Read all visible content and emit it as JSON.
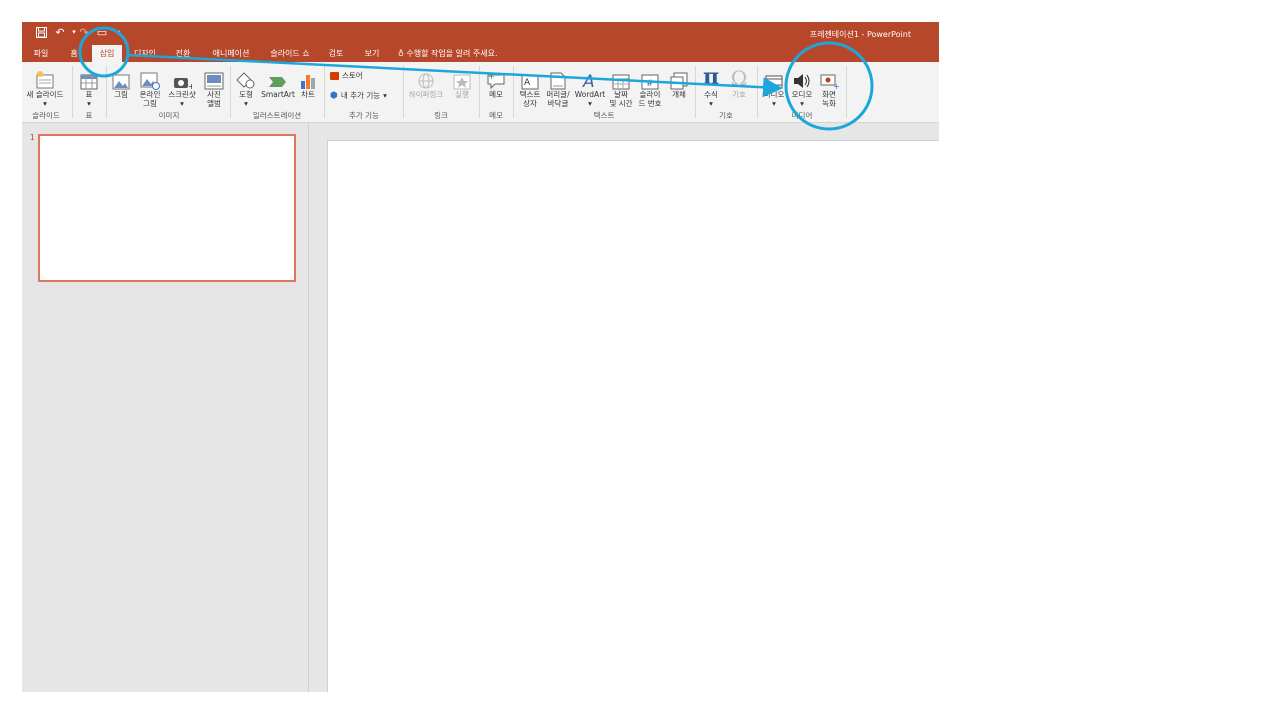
{
  "window": {
    "title": "프레젠테이션1 - PowerPoint"
  },
  "tabs": [
    "파일",
    "홈",
    "삽입",
    "디자인",
    "전환",
    "애니메이션",
    "슬라이드 쇼",
    "검토",
    "보기"
  ],
  "tell_me": "수행할 작업을 알려 주세요.",
  "ribbon": {
    "new_slide": "새 슬라이드",
    "table": "표",
    "picture": "그림",
    "online_picture": "온라인\n그림",
    "screenshot": "스크린샷",
    "photo_album": "사진\n앨범",
    "shapes": "도형",
    "smartart": "SmartArt",
    "chart": "차트",
    "store": "스토어",
    "my_addins": "내 추가 기능",
    "hyperlink": "하이퍼링크",
    "action": "실행",
    "comment": "메모",
    "textbox": "텍스트\n상자",
    "header_footer": "머리글/\n바닥글",
    "wordart": "WordArt",
    "date_time": "날짜\n및 시간",
    "slide_number": "슬라이\n드 번호",
    "object": "개체",
    "equation": "수식",
    "symbol": "기호",
    "video": "비디오",
    "audio": "오디오",
    "screen_recording": "화면\n녹화"
  },
  "groups": {
    "slides": "슬라이드",
    "tables": "표",
    "images": "이미지",
    "illustrations": "일러스트레이션",
    "addins": "추가 기능",
    "links": "링크",
    "comments": "메모",
    "text": "텍스트",
    "symbols": "기호",
    "media": "미디어"
  },
  "thumbnails": [
    {
      "number": "1"
    }
  ],
  "colors": {
    "accent": "#b7472a",
    "annotation": "#1ba7dc",
    "selection": "#e1765d"
  }
}
